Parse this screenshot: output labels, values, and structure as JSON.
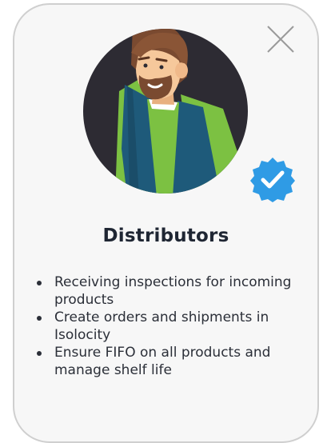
{
  "card": {
    "title": "Distributors",
    "points": [
      "Receiving inspections for incoming products",
      "Create orders and shipments in Isolocity",
      "Ensure FIFO on all products and manage shelf life"
    ]
  },
  "icons": {
    "close": "close-icon",
    "verified": "verified-badge-icon",
    "avatar": "person-avatar"
  },
  "colors": {
    "card_border": "#cfcfcf",
    "card_bg": "#f7f7f7",
    "avatar_circle": "#2d2b33",
    "verified_blue": "#2f9be5",
    "vest": "#1e5a7a",
    "shirt_green": "#7cc142",
    "hair": "#7a4a30",
    "skin": "#f6c89b",
    "title_text": "#1f2633"
  }
}
